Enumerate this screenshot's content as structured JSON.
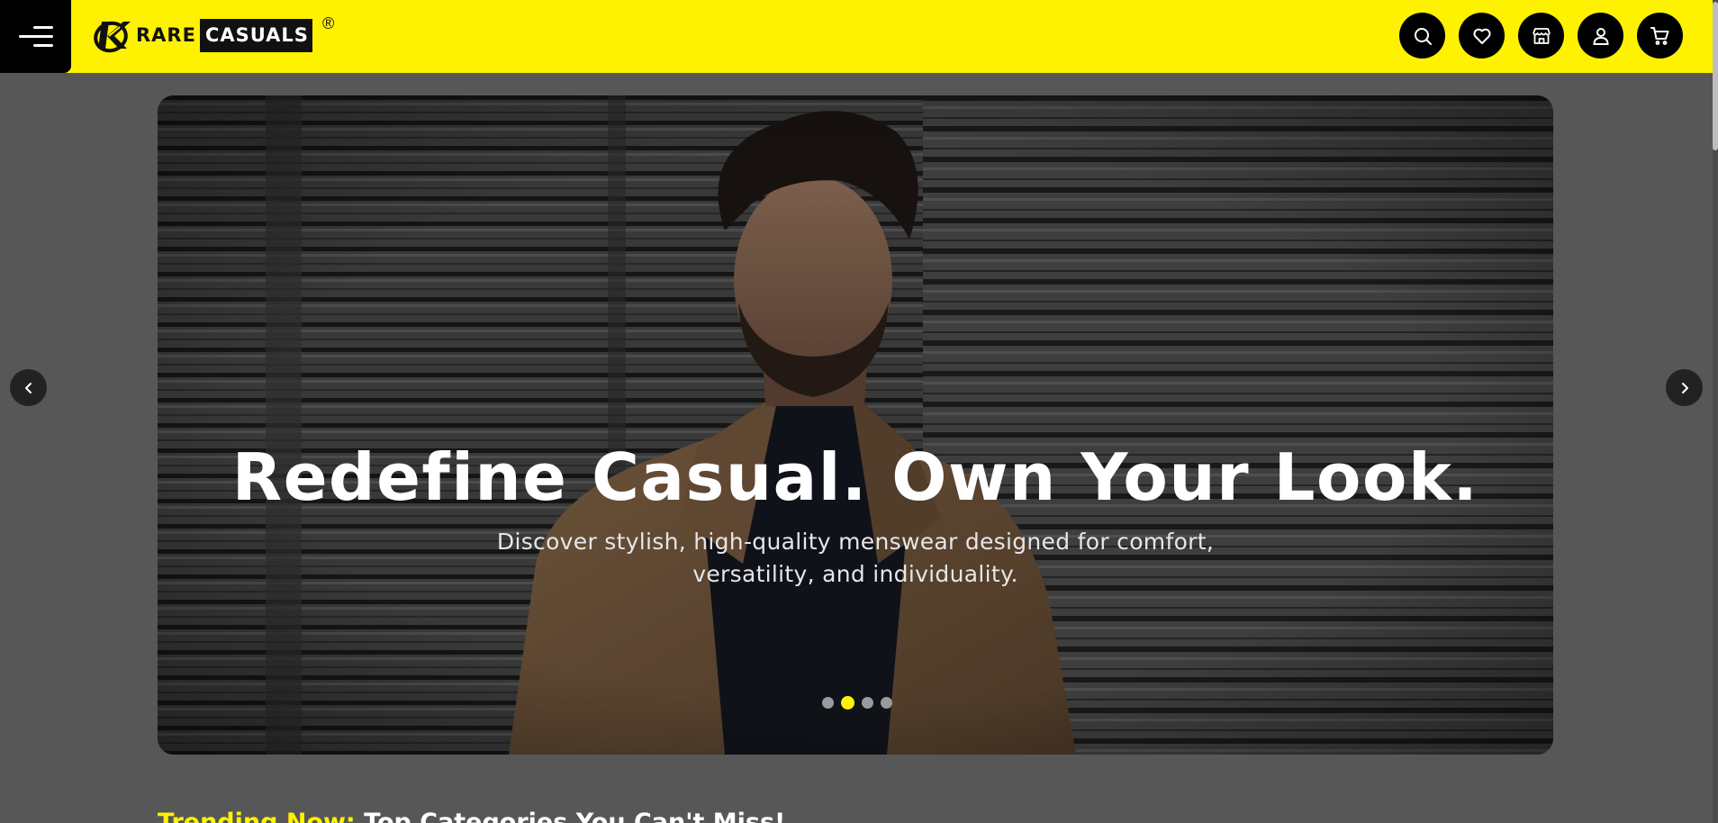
{
  "header": {
    "logo_rare": "RARE",
    "logo_casuals": "CASUALS",
    "logo_reg": "®",
    "icons": [
      "search-icon",
      "heart-icon",
      "store-icon",
      "user-icon",
      "cart-icon"
    ],
    "bg_color": "#fff200"
  },
  "hero": {
    "title": "Redefine Casual. Own Your Look.",
    "subtitle_line1": "Discover stylish, high-quality menswear designed for comfort,",
    "subtitle_line2": "versatility, and individuality.",
    "slide_count": 4,
    "active_slide": 2
  },
  "trending": {
    "highlight": "Trending Now:",
    "rest": " Top Categories You Can't Miss!"
  },
  "colors": {
    "accent": "#fff200",
    "page_bg": "#575757"
  }
}
